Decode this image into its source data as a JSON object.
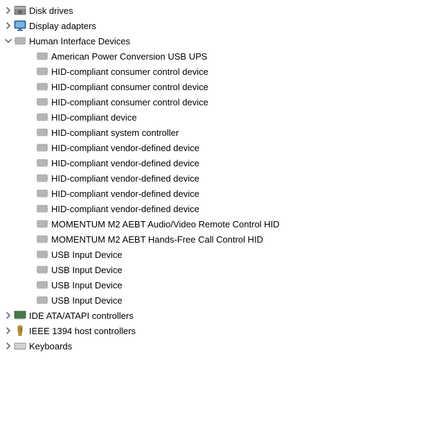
{
  "tree": {
    "items": [
      {
        "id": "disk-drives",
        "level": 0,
        "expander": "collapsed",
        "icon": "disk-drive-icon",
        "label": "Disk drives",
        "indent": 4
      },
      {
        "id": "display-adapters",
        "level": 0,
        "expander": "collapsed",
        "icon": "display-adapter-icon",
        "label": "Display adapters",
        "indent": 4
      },
      {
        "id": "human-interface-devices",
        "level": 0,
        "expander": "expanded",
        "icon": "hid-icon",
        "label": "Human Interface Devices",
        "indent": 4
      },
      {
        "id": "american-power",
        "level": 1,
        "expander": "none",
        "icon": "hid-icon",
        "label": "American Power Conversion USB UPS",
        "indent": 36
      },
      {
        "id": "hid-consumer-1",
        "level": 1,
        "expander": "none",
        "icon": "hid-icon",
        "label": "HID-compliant consumer control device",
        "indent": 36
      },
      {
        "id": "hid-consumer-2",
        "level": 1,
        "expander": "none",
        "icon": "hid-icon",
        "label": "HID-compliant consumer control device",
        "indent": 36
      },
      {
        "id": "hid-consumer-3",
        "level": 1,
        "expander": "none",
        "icon": "hid-icon",
        "label": "HID-compliant consumer control device",
        "indent": 36
      },
      {
        "id": "hid-device",
        "level": 1,
        "expander": "none",
        "icon": "hid-icon",
        "label": "HID-compliant device",
        "indent": 36
      },
      {
        "id": "hid-system",
        "level": 1,
        "expander": "none",
        "icon": "hid-icon",
        "label": "HID-compliant system controller",
        "indent": 36
      },
      {
        "id": "hid-vendor-1",
        "level": 1,
        "expander": "none",
        "icon": "hid-icon",
        "label": "HID-compliant vendor-defined device",
        "indent": 36
      },
      {
        "id": "hid-vendor-2",
        "level": 1,
        "expander": "none",
        "icon": "hid-icon",
        "label": "HID-compliant vendor-defined device",
        "indent": 36
      },
      {
        "id": "hid-vendor-3",
        "level": 1,
        "expander": "none",
        "icon": "hid-icon",
        "label": "HID-compliant vendor-defined device",
        "indent": 36
      },
      {
        "id": "hid-vendor-4",
        "level": 1,
        "expander": "none",
        "icon": "hid-icon",
        "label": "HID-compliant vendor-defined device",
        "indent": 36
      },
      {
        "id": "hid-vendor-5",
        "level": 1,
        "expander": "none",
        "icon": "hid-icon",
        "label": "HID-compliant vendor-defined device",
        "indent": 36
      },
      {
        "id": "momentum-m2-1",
        "level": 1,
        "expander": "none",
        "icon": "hid-icon",
        "label": "MOMENTUM M2 AEBT Audio/Video Remote Control HID",
        "indent": 36
      },
      {
        "id": "momentum-m2-2",
        "level": 1,
        "expander": "none",
        "icon": "hid-icon",
        "label": "MOMENTUM M2 AEBT Hands-Free Call Control HID",
        "indent": 36
      },
      {
        "id": "usb-input-1",
        "level": 1,
        "expander": "none",
        "icon": "hid-icon",
        "label": "USB Input Device",
        "indent": 36
      },
      {
        "id": "usb-input-2",
        "level": 1,
        "expander": "none",
        "icon": "hid-icon",
        "label": "USB Input Device",
        "indent": 36
      },
      {
        "id": "usb-input-3",
        "level": 1,
        "expander": "none",
        "icon": "hid-icon",
        "label": "USB Input Device",
        "indent": 36
      },
      {
        "id": "usb-input-4",
        "level": 1,
        "expander": "none",
        "icon": "hid-icon",
        "label": "USB Input Device",
        "indent": 36
      },
      {
        "id": "ide-controllers",
        "level": 0,
        "expander": "collapsed",
        "icon": "ide-icon",
        "label": "IDE ATA/ATAPI controllers",
        "indent": 4
      },
      {
        "id": "ieee-1394",
        "level": 0,
        "expander": "collapsed",
        "icon": "ieee-icon",
        "label": "IEEE 1394 host controllers",
        "indent": 4
      },
      {
        "id": "keyboards",
        "level": 0,
        "expander": "collapsed",
        "icon": "keyboard-icon",
        "label": "Keyboards",
        "indent": 4
      }
    ]
  }
}
